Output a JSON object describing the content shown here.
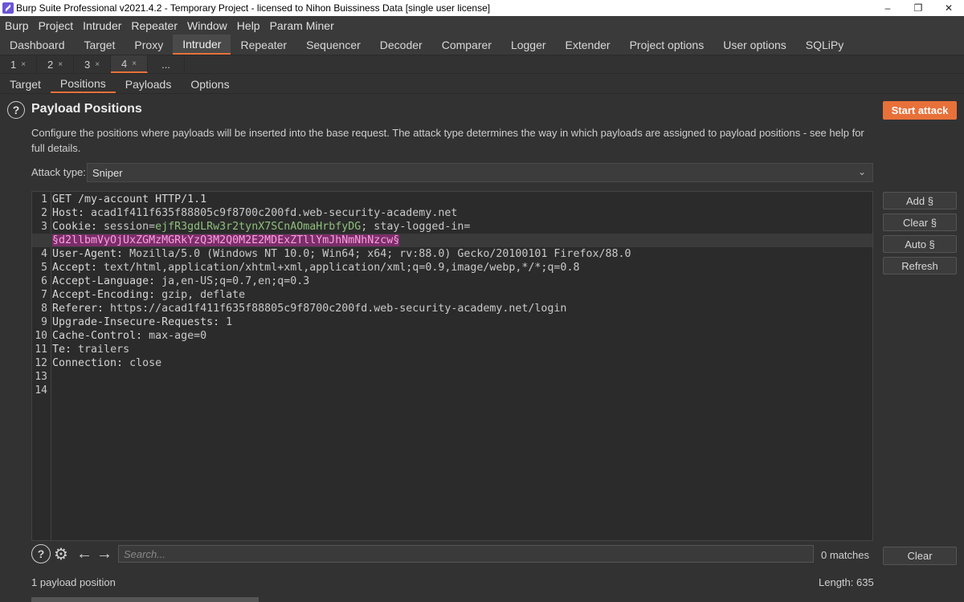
{
  "window": {
    "title": "Burp Suite Professional v2021.4.2 - Temporary Project - licensed to Nihon Buissiness Data [single user license]",
    "minimize": "–",
    "restore": "❐",
    "close": "✕"
  },
  "menu": [
    "Burp",
    "Project",
    "Intruder",
    "Repeater",
    "Window",
    "Help",
    "Param Miner"
  ],
  "main_tabs": [
    "Dashboard",
    "Target",
    "Proxy",
    "Intruder",
    "Repeater",
    "Sequencer",
    "Decoder",
    "Comparer",
    "Logger",
    "Extender",
    "Project options",
    "User options",
    "SQLiPy"
  ],
  "sub_tabs": [
    {
      "label": "1",
      "close": "×"
    },
    {
      "label": "2",
      "close": "×"
    },
    {
      "label": "3",
      "close": "×"
    },
    {
      "label": "4",
      "close": "×"
    },
    {
      "label": "...",
      "close": ""
    }
  ],
  "section_tabs": [
    "Target",
    "Positions",
    "Payloads",
    "Options"
  ],
  "header": {
    "help": "?",
    "title": "Payload Positions",
    "start_attack": "Start attack",
    "description": "Configure the positions where payloads will be inserted into the base request. The attack type determines the way in which payloads are assigned to payload positions - see help for full details."
  },
  "attack_type": {
    "label": "Attack type:",
    "value": "Sniper",
    "chevron": "⌄"
  },
  "request": {
    "line1": {
      "num": "1",
      "text": "GET /my-account HTTP/1.1"
    },
    "line2": {
      "num": "2",
      "name": "Host:",
      "value": " acad1f411f635f88805c9f8700c200fd.web-security-academy.net"
    },
    "line3": {
      "num": "3",
      "name": "Cookie:",
      "pre": " session=",
      "session": "ejfR3gdLRw3r2tynX7SCnAOmaHrbfyDG",
      "mid": "; stay-logged-in=",
      "payload": "§d2llbmVyOjUxZGMzMGRkYzQ3M2Q0M2E2MDExZTllYmJhNmNhNzcw§"
    },
    "line4": {
      "num": "4",
      "name": "User-Agent:",
      "value": " Mozilla/5.0 (Windows NT 10.0; Win64; x64; rv:88.0) Gecko/20100101 Firefox/88.0"
    },
    "line5": {
      "num": "5",
      "name": "Accept:",
      "value": " text/html,application/xhtml+xml,application/xml;q=0.9,image/webp,*/*;q=0.8"
    },
    "line6": {
      "num": "6",
      "name": "Accept-Language:",
      "value": " ja,en-US;q=0.7,en;q=0.3"
    },
    "line7": {
      "num": "7",
      "name": "Accept-Encoding:",
      "value": " gzip, deflate"
    },
    "line8": {
      "num": "8",
      "name": "Referer:",
      "value": " https://acad1f411f635f88805c9f8700c200fd.web-security-academy.net/login"
    },
    "line9": {
      "num": "9",
      "name": "Upgrade-Insecure-Requests:",
      "value": " 1"
    },
    "line10": {
      "num": "10",
      "name": "Cache-Control:",
      "value": " max-age=0"
    },
    "line11": {
      "num": "11",
      "name": "Te:",
      "value": " trailers"
    },
    "line12": {
      "num": "12",
      "name": "Connection:",
      "value": " close"
    },
    "line13": {
      "num": "13"
    },
    "line14": {
      "num": "14"
    }
  },
  "side_buttons": {
    "add": "Add §",
    "clear": "Clear §",
    "auto": "Auto §",
    "refresh": "Refresh"
  },
  "search": {
    "help": "?",
    "settings": "⚙",
    "back": "←",
    "forward": "→",
    "placeholder": "Search...",
    "matches": "0 matches",
    "clear": "Clear"
  },
  "status": {
    "positions": "1 payload position",
    "length": "Length: 635"
  },
  "colors": {
    "accent": "#e8713a",
    "payload_bg": "#7a2e6a",
    "payload_fg": "#ff9ee0",
    "session_value": "#8ec07c"
  }
}
